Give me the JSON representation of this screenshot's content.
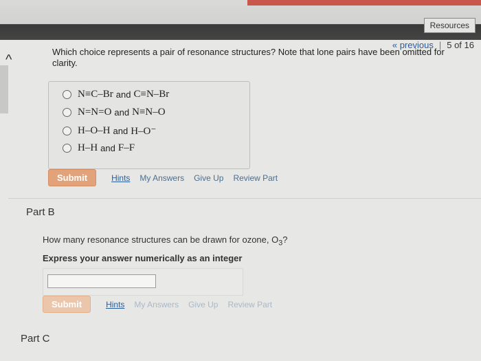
{
  "header": {
    "resources_label": "Resources",
    "previous_label": "« previous",
    "page_indicator": "5 of 16"
  },
  "partA": {
    "question": "Which choice represents a pair of resonance structures? Note that lone pairs have been omitted for clarity.",
    "choices": [
      {
        "left": "N≡C–Br",
        "and": "and",
        "right": "C≡N–Br"
      },
      {
        "left": "N=N=O",
        "and": "and",
        "right": "N≡N–O"
      },
      {
        "left": "H–O–H",
        "and": "and",
        "right": "H–O⁻"
      },
      {
        "left": "H–H",
        "and": "and",
        "right": "F–F"
      }
    ],
    "buttons": {
      "submit": "Submit",
      "hints": "Hints",
      "my_answers": "My Answers",
      "give_up": "Give Up",
      "review_part": "Review Part"
    }
  },
  "partB": {
    "title": "Part B",
    "question_prefix": "How many resonance structures can be drawn for ozone, O",
    "question_sub": "3",
    "question_suffix": "?",
    "instruction": "Express your answer numerically as an integer",
    "answer_value": "",
    "buttons": {
      "submit": "Submit",
      "hints": "Hints",
      "my_answers": "My Answers",
      "give_up": "Give Up",
      "review_part": "Review Part"
    }
  },
  "partC": {
    "title": "Part C"
  }
}
